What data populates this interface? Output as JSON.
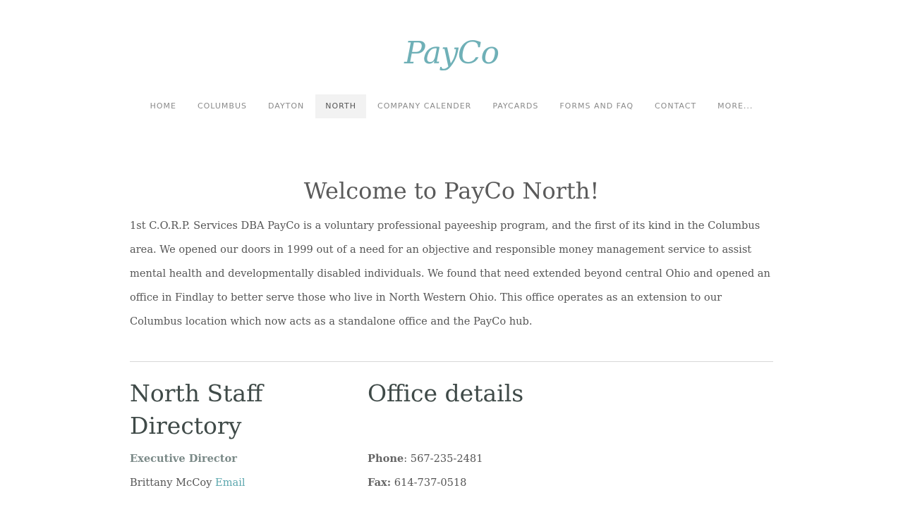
{
  "site": {
    "logo_text": "PayCo"
  },
  "nav": {
    "items": [
      {
        "label": "HOME"
      },
      {
        "label": "COLUMBUS"
      },
      {
        "label": "DAYTON"
      },
      {
        "label": "NORTH",
        "active": true
      },
      {
        "label": "COMPANY CALENDER"
      },
      {
        "label": "PAYCARDS"
      },
      {
        "label": "FORMS AND FAQ"
      },
      {
        "label": "CONTACT"
      },
      {
        "label": "MORE..."
      }
    ]
  },
  "main": {
    "title": "Welcome to PayCo North!",
    "intro": "1st C.O.R.P. Services DBA PayCo is a voluntary professional payeeship program, and the first of its kind in the Columbus area. We opened our doors in 1999 out of a need for an objective and responsible money management service to assist mental health and developmentally disabled individuals. We found that need extended beyond central Ohio and opened an office in Findlay to better serve those who live in North Western Ohio. This office operates as an extension to our Columbus location which now acts as a standalone office and the PayCo hub."
  },
  "staff": {
    "heading": "North Staff Directory",
    "role": "Executive Director",
    "name": "Brittany McCoy",
    "email_link": "Email"
  },
  "office": {
    "heading": "Office details",
    "phone_label": "Phone",
    "phone_value": "567-235-2481",
    "fax_label": "Fax:",
    "fax_value": "614-737-0518"
  },
  "colors": {
    "accent": "#6fb0b7",
    "link": "#5aa6ad",
    "text": "#555555",
    "heading": "#3f4a48"
  }
}
